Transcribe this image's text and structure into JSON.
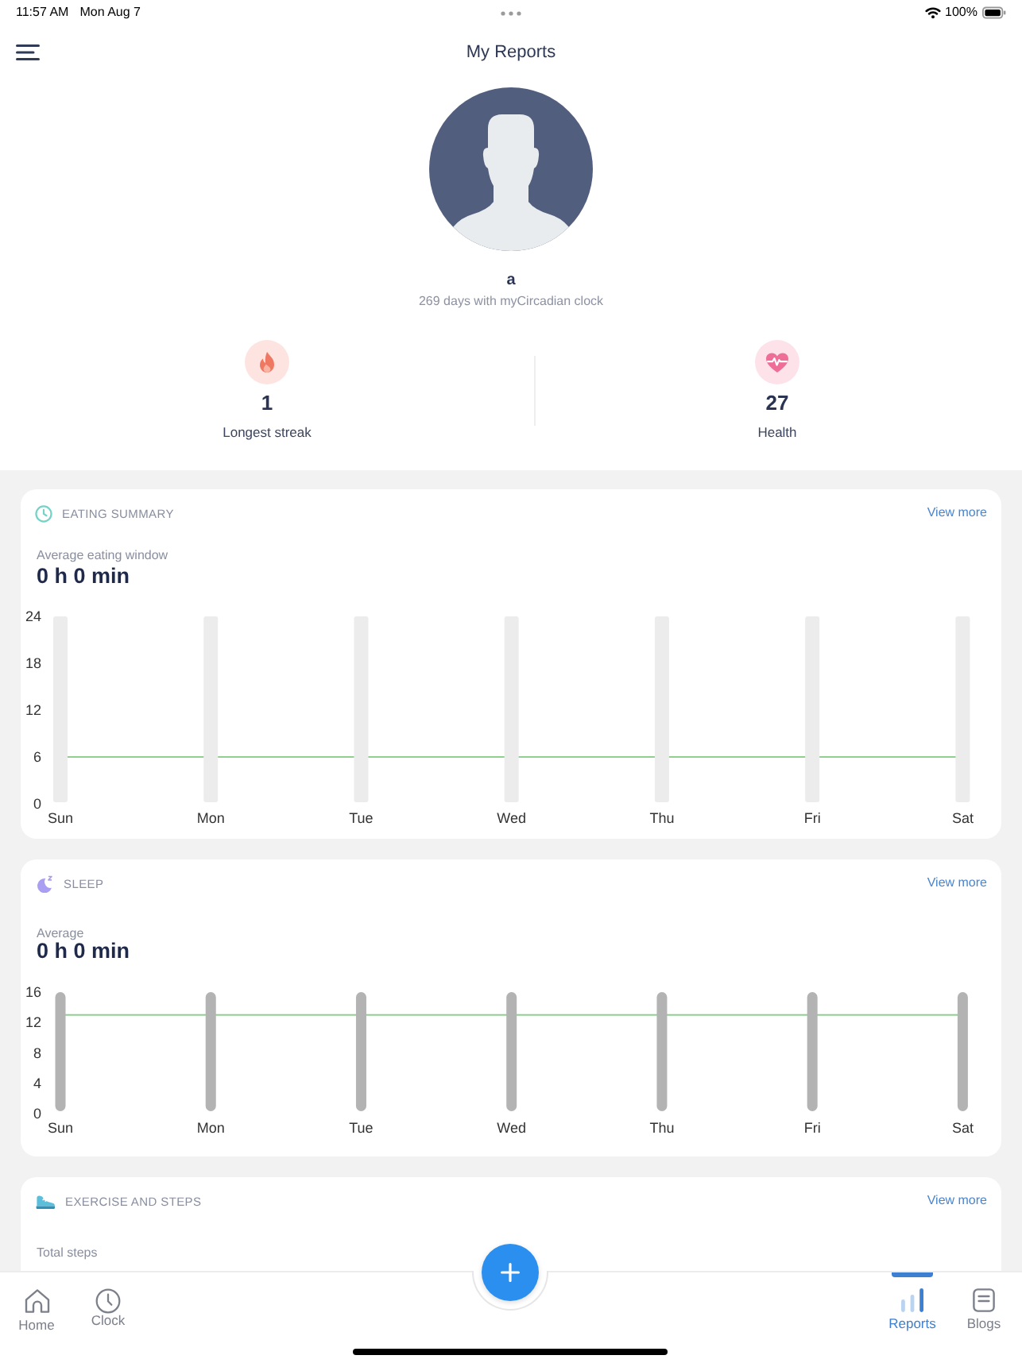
{
  "status_bar": {
    "time": "11:57 AM",
    "date": "Mon Aug 7",
    "battery": "100%"
  },
  "header": {
    "title": "My Reports"
  },
  "profile": {
    "name": "a",
    "subtitle": "269 days with myCircadian clock"
  },
  "stats": [
    {
      "kind": "streak",
      "value": "1",
      "label": "Longest streak"
    },
    {
      "kind": "health",
      "value": "27",
      "label": "Health"
    }
  ],
  "cards": [
    {
      "kind": "eating",
      "title": "EATING SUMMARY",
      "link": "View more",
      "metric_label": "Average eating window",
      "metric_value": "0 h 0 min",
      "chart_data": {
        "type": "bar",
        "categories": [
          "Sun",
          "Mon",
          "Tue",
          "Wed",
          "Thu",
          "Fri",
          "Sat"
        ],
        "series": [
          {
            "color": "#ececec",
            "values": [
              24,
              24,
              24,
              24,
              24,
              24,
              24
            ]
          }
        ],
        "ylim": [
          0,
          24
        ],
        "yticks": [
          0,
          6,
          12,
          18,
          24
        ],
        "ref_lines": [
          {
            "axis": "y",
            "value": 6
          }
        ]
      }
    },
    {
      "kind": "sleep",
      "title": "SLEEP",
      "link": "View more",
      "metric_label": "Average",
      "metric_value": "0 h 0 min",
      "chart_data": {
        "type": "bar",
        "categories": [
          "Sun",
          "Mon",
          "Tue",
          "Wed",
          "Thu",
          "Fri",
          "Sat"
        ],
        "series": [
          {
            "color": "#b3b3b3",
            "values": [
              16,
              16,
              16,
              16,
              16,
              16,
              16
            ]
          }
        ],
        "ylim": [
          0,
          16
        ],
        "yticks": [
          0,
          4,
          8,
          12,
          16
        ],
        "ref_lines": [
          {
            "axis": "y",
            "value": 13
          }
        ]
      }
    },
    {
      "kind": "exercise",
      "title": "EXERCISE AND STEPS",
      "link": "View more",
      "metric_label": "Total steps"
    }
  ],
  "tabs": [
    {
      "label": "Home",
      "selected": false
    },
    {
      "label": "Clock",
      "selected": false
    },
    {
      "label": "Reports",
      "selected": true
    },
    {
      "label": "Blogs",
      "selected": false
    }
  ]
}
